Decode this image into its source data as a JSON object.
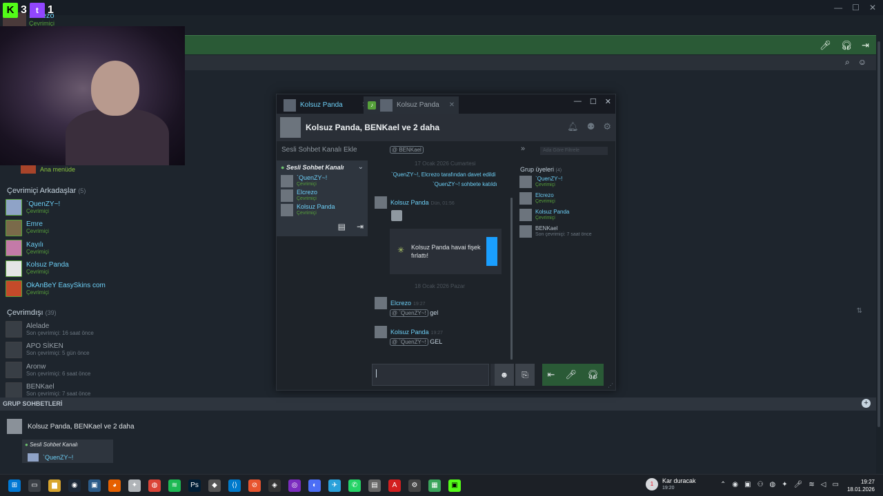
{
  "me": {
    "name": "Elcrezo",
    "status": "Çevrimiçi"
  },
  "stream": {
    "kick_count": "3",
    "twitch_count": "1"
  },
  "window_controls": {
    "minimize": "—",
    "maximize": "☐",
    "close": "✕"
  },
  "current_activity": "Ana menüde",
  "online_section": {
    "title": "Çevrimiçi Arkadaşlar",
    "count": "(5)"
  },
  "online_friends": [
    {
      "name": "`QuenZY~!",
      "status": "Çevrimiçi",
      "color": "#8fa3c7"
    },
    {
      "name": "Emre",
      "status": "Çevrimiçi",
      "color": "#7a6a4a"
    },
    {
      "name": "Kayılı",
      "status": "Çevrimiçi",
      "color": "#c47aa8"
    },
    {
      "name": "Kolsuz Panda",
      "status": "Çevrimiçi",
      "color": "#e5e5e5"
    },
    {
      "name": "OkAnBeY EasySkins com",
      "status": "Çevrimiçi",
      "color": "#c44a2a"
    }
  ],
  "offline_section": {
    "title": "Çevrimdışı",
    "count": "(39)"
  },
  "offline_friends": [
    {
      "name": "Alelade",
      "status": "Son çevrimiçi: 16 saat önce"
    },
    {
      "name": "APO SİKEN",
      "status": "Son çevrimiçi: 5 gün önce"
    },
    {
      "name": "Aronw",
      "status": "Son çevrimiçi: 6 saat önce"
    },
    {
      "name": "BENKael",
      "status": "Son çevrimiçi: 7 saat önce"
    }
  ],
  "groups": {
    "header": "GRUP SOHBETLERİ",
    "group_name": "Kolsuz Panda, BENKael ve 2 daha",
    "voice_channel": "Sesli Sohbet Kanalı",
    "voice_member": "`QuenZY~!"
  },
  "chat": {
    "tabs": [
      {
        "label": "Kolsuz Panda",
        "close": "✕"
      },
      {
        "label": "Kolsuz Panda",
        "close": "✕"
      }
    ],
    "title": "Kolsuz Panda, BENKael ve 2 daha",
    "add_voice_channel": "Sesli Sohbet Kanalı Ekle",
    "voice_channel": "Sesli Sohbet Kanalı",
    "voice_members": [
      {
        "name": "`QuenZY~!",
        "status": "Çevrimiçi"
      },
      {
        "name": "Elcrezo",
        "status": "Çevrimiçi"
      },
      {
        "name": "Kolsuz Panda",
        "status": "Çevrimiçi"
      }
    ],
    "top_mention": "@ BENKael",
    "date1": "17 Ocak 2026 Cumartesi",
    "sys1": "`QuenZY~!, Elcrezo tarafından davet edildi",
    "sys2": "`QuenZY~! sohbete katıldı",
    "msg1": {
      "name": "Kolsuz Panda",
      "time": "Dün, 01:56"
    },
    "firework": "Kolsuz Panda havai fişek fırlattı!",
    "date2": "18 Ocak 2026 Pazar",
    "msg2": {
      "name": "Elcrezo",
      "time": "19:27",
      "mention": "@ `QuenZY~!",
      "text": "gel"
    },
    "msg3": {
      "name": "Kolsuz Panda",
      "time": "19:27",
      "mention": "@ `QuenZY~!",
      "text": "GEL"
    },
    "filter_placeholder": "Ada Göre Filtrele",
    "members_header": "Grup üyeleri",
    "members_count": "(4)",
    "members": [
      {
        "name": "`QuenZY~!",
        "status": "Çevrimiçi"
      },
      {
        "name": "Elcrezo",
        "status": "Çevrimiçi"
      },
      {
        "name": "Kolsuz Panda",
        "status": "Çevrimiçi"
      },
      {
        "name": "BENKael",
        "status": "Son çevrimiçi: 7 saat önce"
      }
    ],
    "input_value": ""
  },
  "taskbar": {
    "weather_title": "Kar duracak",
    "weather_time": "19:20",
    "time": "19:27",
    "date": "18.01.2026",
    "notif_badge": "1"
  },
  "colors": {
    "accent": "#6dcff6",
    "online": "#57a13b",
    "voice": "#2a5a36"
  }
}
